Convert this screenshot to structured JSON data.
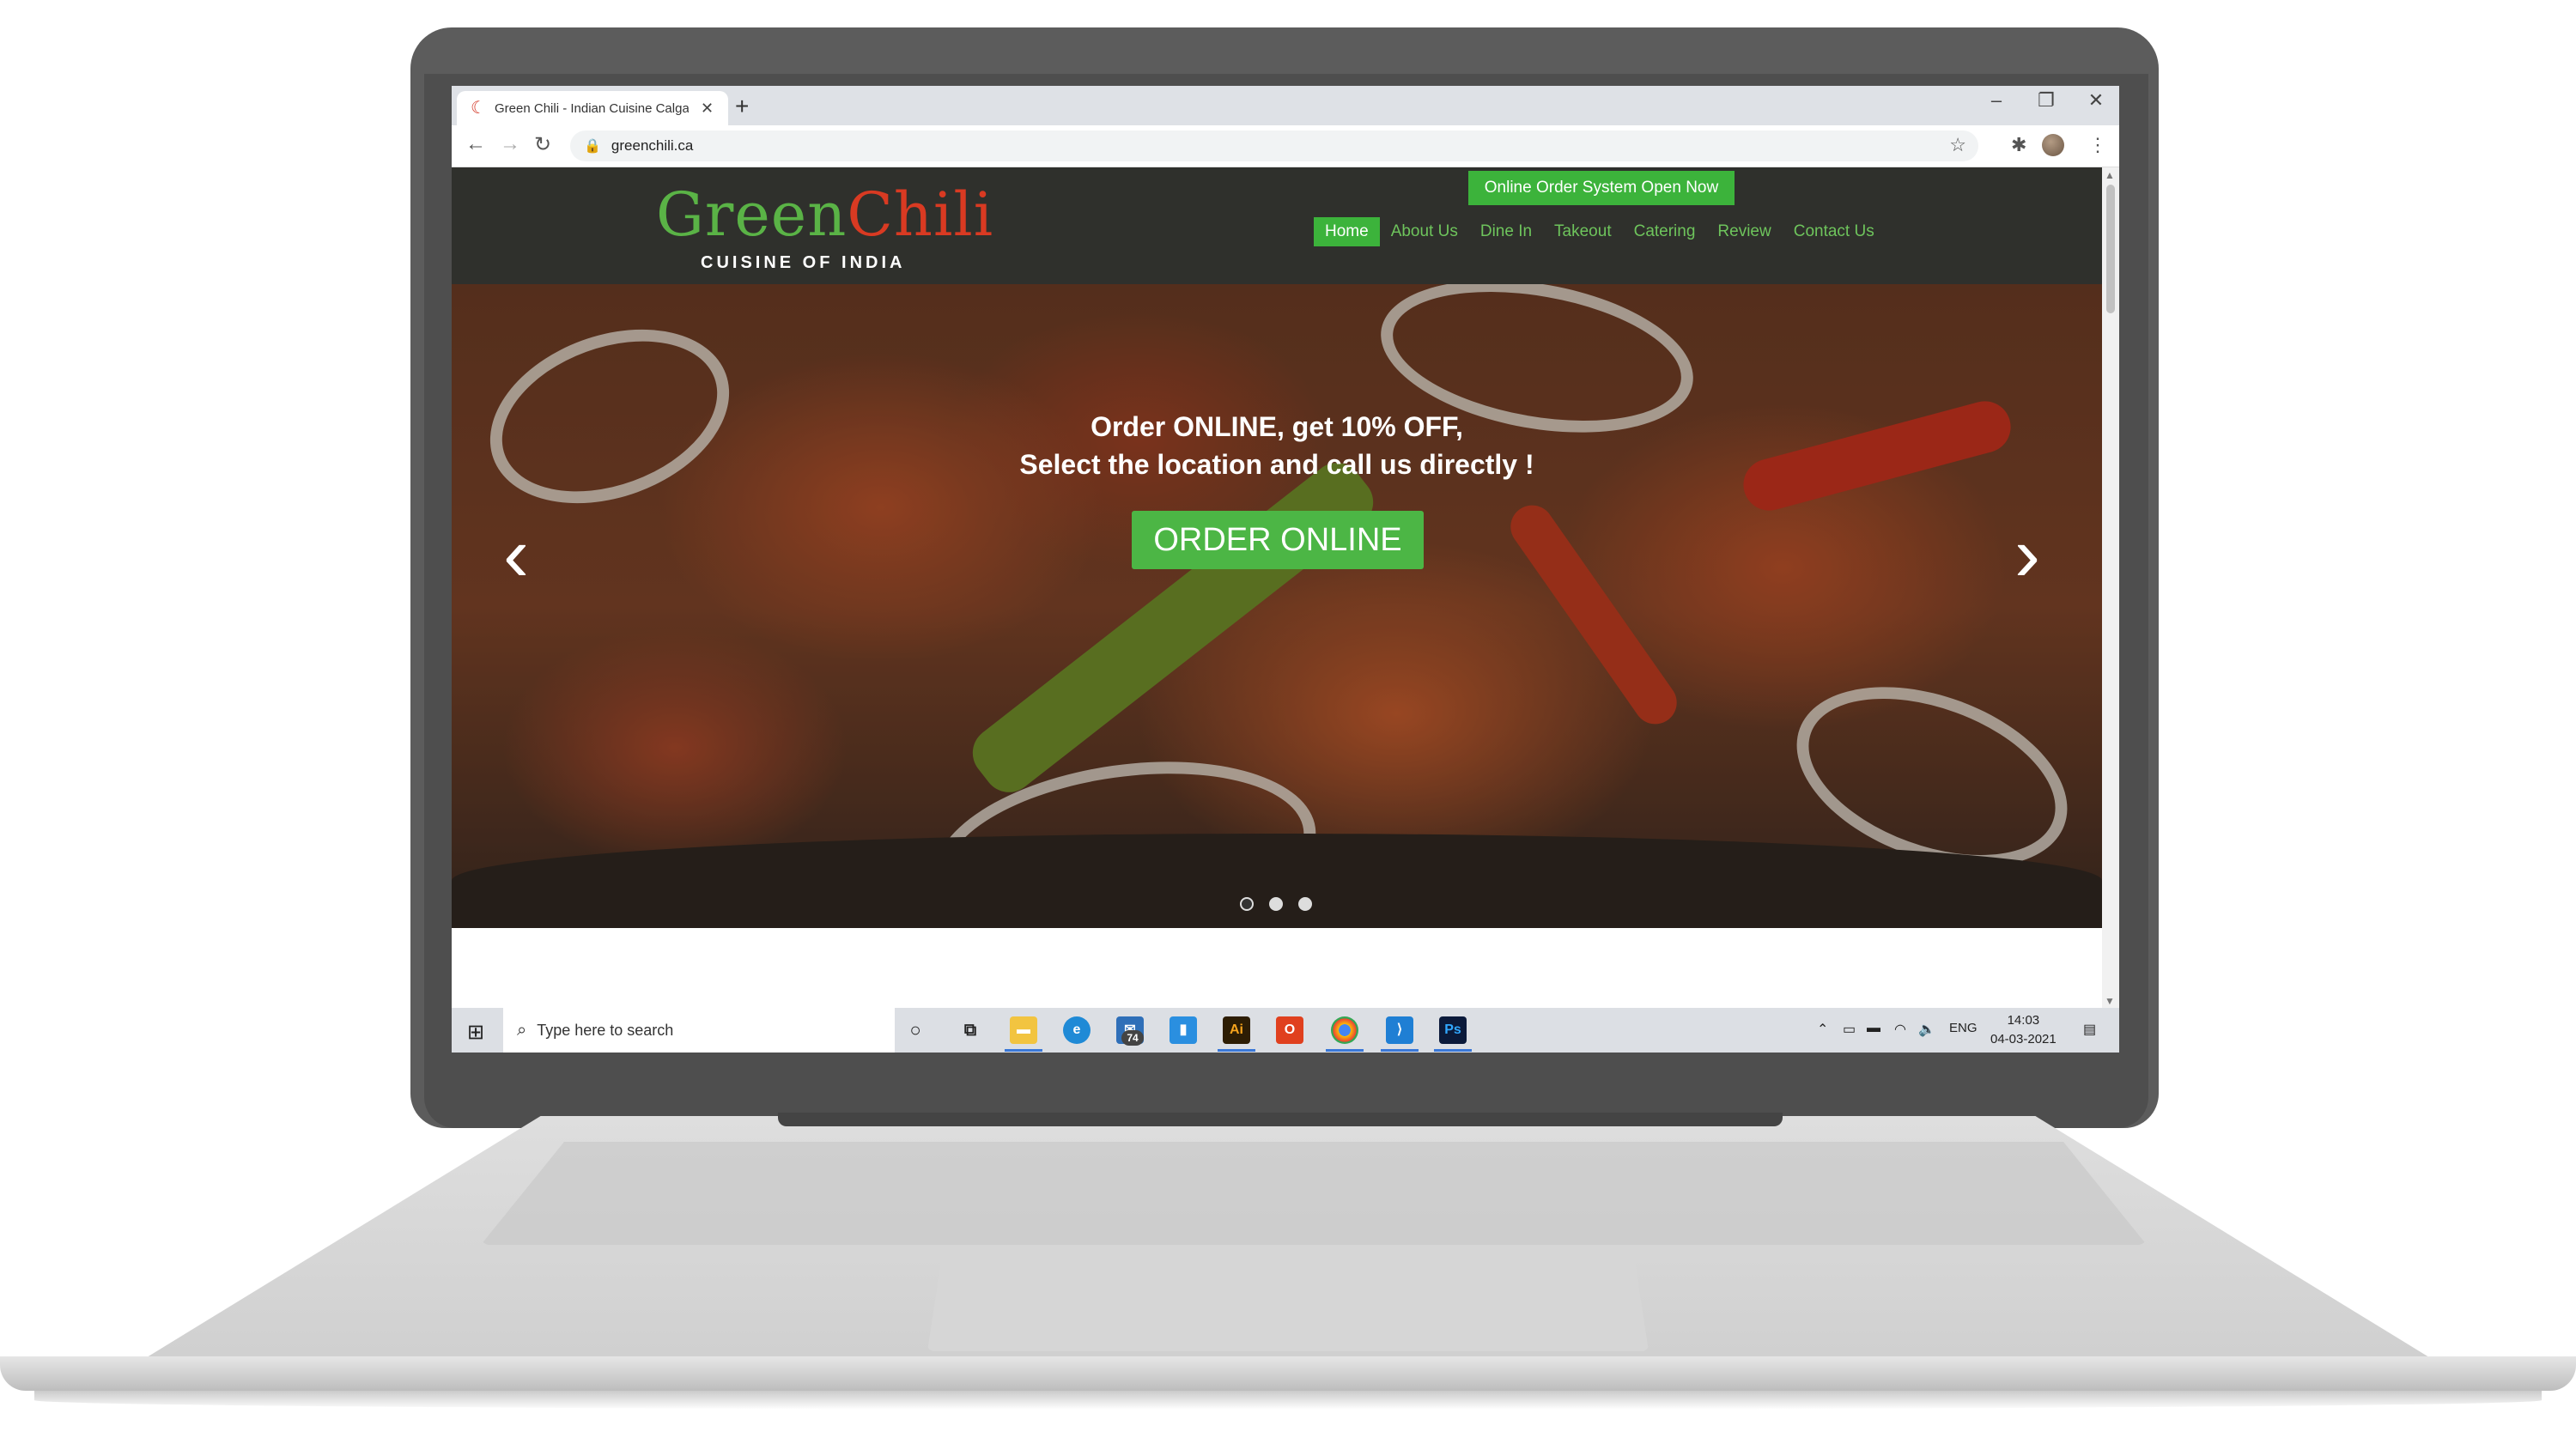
{
  "browser": {
    "tab_title": "Green Chili - Indian Cuisine Calgary",
    "url": "greenchili.ca",
    "tab_icon": "chili-icon"
  },
  "site": {
    "logo_main": "Green",
    "logo_accent": "Chili",
    "logo_sub": "CUISINE OF INDIA",
    "order_banner": "Online Order System Open Now",
    "nav": [
      "Home",
      "About Us",
      "Dine In",
      "Takeout",
      "Catering",
      "Review",
      "Contact Us"
    ],
    "nav_active": "Home",
    "hero": {
      "line1": "Order ONLINE, get 10% OFF,",
      "line2": "Select the location and call us directly !",
      "button": "ORDER ONLINE",
      "slides": 3,
      "active_slide": 1
    }
  },
  "taskbar": {
    "search_placeholder": "Type here to search",
    "mail_badge": "74",
    "language": "ENG",
    "time": "14:03",
    "date": "04-03-2021"
  },
  "colors": {
    "brand_green": "#3cb33b",
    "chili_red": "#d93a22",
    "header_bg": "#2f302c"
  }
}
